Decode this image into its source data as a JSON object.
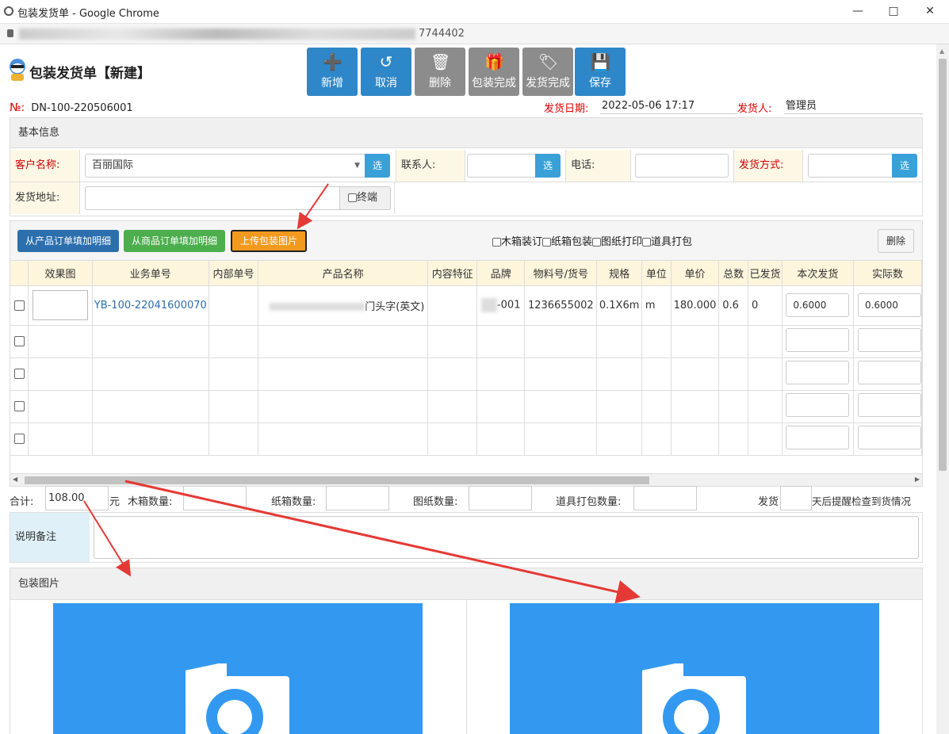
{
  "window": {
    "title": "包装发货单 - Google Chrome",
    "url_tail": "7744402"
  },
  "page": {
    "title": "包装发货单【新建】"
  },
  "toolbar": [
    {
      "icon": "plus-circle-icon",
      "label": "新增",
      "color": "#2e87c8"
    },
    {
      "icon": "undo-icon",
      "label": "取消",
      "color": "#2e87c8"
    },
    {
      "icon": "trash-icon",
      "label": "删除",
      "color": "#8c8c8c"
    },
    {
      "icon": "gift-icon",
      "label": "包装完成",
      "color": "#8c8c8c"
    },
    {
      "icon": "tag-icon",
      "label": "发货完成",
      "color": "#8c8c8c"
    },
    {
      "icon": "save-icon",
      "label": "保存",
      "color": "#2e87c8"
    }
  ],
  "doc": {
    "no_label": "№:",
    "no_value": "DN-100-220506001",
    "ship_date_label": "发货日期:",
    "ship_date_value": "2022-05-06 17:17",
    "shipper_label": "发货人:",
    "shipper_value": "管理员"
  },
  "basic": {
    "header": "基本信息",
    "customer_label": "客户名称:",
    "customer_value": "百丽国际",
    "select_label": "选",
    "contact_label": "联系人:",
    "phone_label": "电话:",
    "ship_method_label": "发货方式:",
    "address_label": "发货地址:",
    "terminal_label": "终端"
  },
  "detail_toolbar": {
    "from_product_order": "从产品订单填加明细",
    "from_goods_order": "从商品订单填加明细",
    "upload_images": "上传包装图片",
    "options": [
      "木箱装订",
      "纸箱包装",
      "图纸打印",
      "道具打包"
    ],
    "delete": "删除"
  },
  "table": {
    "columns": [
      "效果图",
      "业务单号",
      "内部单号",
      "产品名称",
      "内容特征",
      "品牌",
      "物料号/货号",
      "规格",
      "单位",
      "单价",
      "总数",
      "已发货",
      "本次发货",
      "实际数"
    ],
    "rows": [
      {
        "order_no": "YB-100-22041600070",
        "product_name": "门头字(英文)",
        "brand": "-001",
        "material_no": "1236655002",
        "spec": "0.1X6m",
        "unit": "m",
        "price": "180.000",
        "total": "0.6",
        "shipped": "0",
        "this_ship": "0.6000",
        "actual": "0.6000"
      }
    ]
  },
  "totals": {
    "total_label": "合计:",
    "total_value": "108.00",
    "currency": "元",
    "wood_box_label": "木箱数量:",
    "carton_label": "纸箱数量:",
    "drawing_label": "图纸数量:",
    "prop_label": "道具打包数量:",
    "remind_prefix": "发货",
    "remind_suffix": "天后提醒检查到货情况"
  },
  "remark": {
    "label": "说明备注"
  },
  "images": {
    "header": "包装图片"
  },
  "colors": {
    "primary": "#2e87c8",
    "orange": "#f39a1e",
    "green": "#4cae4c",
    "photo_bg": "#3399f0",
    "required": "#cc0000"
  }
}
